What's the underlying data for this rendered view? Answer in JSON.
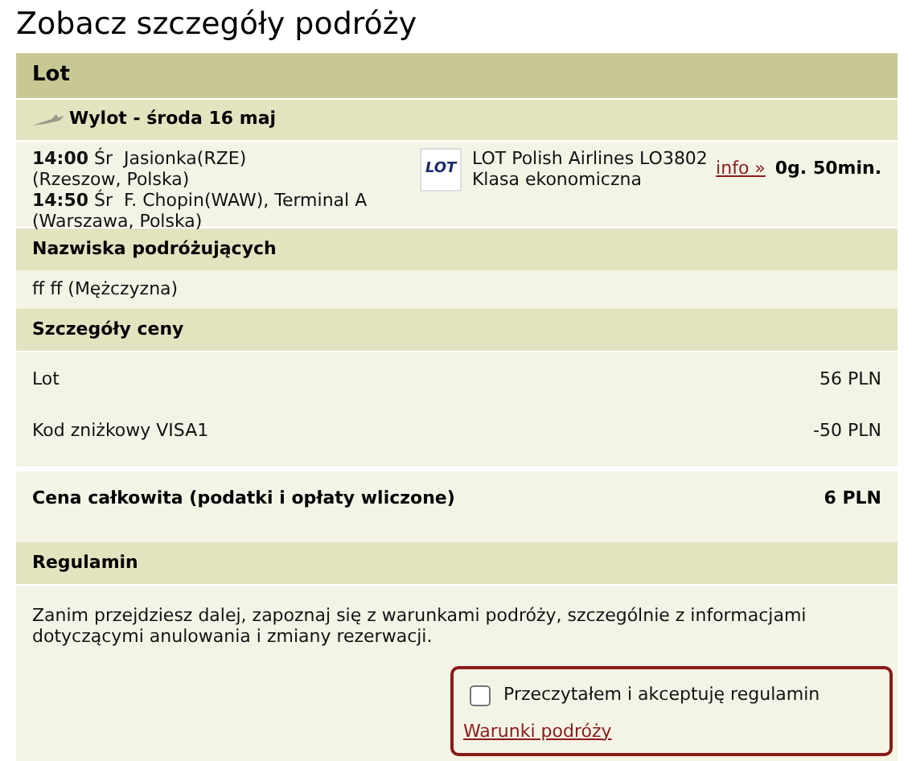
{
  "title": "Zobacz szczegóły podróży",
  "section_title": "Lot",
  "departure": {
    "label": "Wylot - środa 16 maj"
  },
  "flight": {
    "dep_time": "14:00",
    "dep_place": "Śr  Jasionka(RZE)",
    "dep_city": "(Rzeszow, Polska)",
    "arr_time": "14:50",
    "arr_place": "Śr  F. Chopin(WAW), Terminal A",
    "arr_city": "(Warszawa, Polska)",
    "logo": "LOT",
    "airline": "LOT Polish Airlines LO3802",
    "class": "Klasa ekonomiczna",
    "info_link": "info »",
    "duration": "0g. 50min."
  },
  "passengers": {
    "title": "Nazwiska podróżujących",
    "names": [
      "ff ff (Mężczyzna)"
    ]
  },
  "price": {
    "title": "Szczegóły ceny",
    "items": [
      {
        "label": "Lot",
        "amount": "56 PLN"
      },
      {
        "label": "Kod zniżkowy VISA1",
        "amount": "-50 PLN"
      }
    ],
    "total_label": "Cena całkowita (podatki i opłaty wliczone)",
    "total_amount": "6 PLN"
  },
  "terms": {
    "title": "Regulamin",
    "text": "Zanim przejdziesz dalej, zapoznaj się z warunkami podróży, szczególnie z informacjami dotyczącymi anulowania i zmiany rezerwacji.",
    "accept_label": "Przeczytałem i akceptuję regulamin",
    "checked": false,
    "link": "Warunki podróży"
  }
}
